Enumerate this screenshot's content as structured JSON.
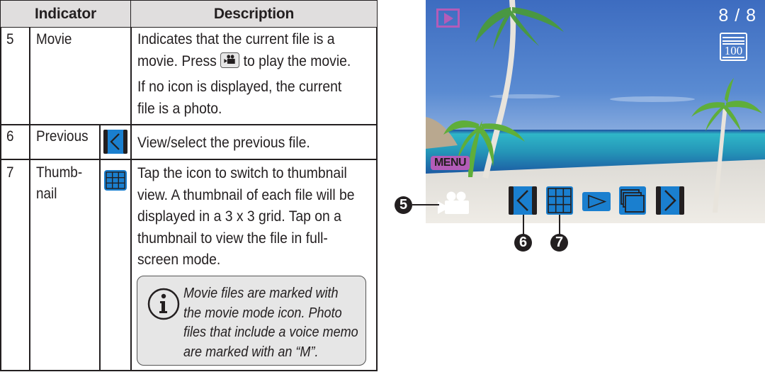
{
  "table": {
    "headers": {
      "indicator": "Indicator",
      "description": "Description"
    },
    "rows": [
      {
        "number": "5",
        "name": "Movie",
        "icon": "",
        "description_lines_1": [
          "Indicates that the current file is a"
        ],
        "description_line_2a": "movie. Press",
        "inline_icon": "movie-camera-button-icon",
        "description_line_2b": "to play the movie.",
        "description_para_2": [
          "If no icon is displayed, the current",
          "file is a photo."
        ]
      },
      {
        "number": "6",
        "name": "Previous",
        "icon": "previous-icon",
        "description": "View/select the previous file."
      },
      {
        "number": "7",
        "name_lines": [
          "Thumb-",
          "nail"
        ],
        "icon": "thumbnail-grid-icon",
        "description_lines": [
          "Tap the icon to switch to thumbnail",
          "view. A thumbnail of each file will be",
          "displayed in a 3 x 3 grid. Tap on a",
          "thumbnail to view the file in full-",
          "screen mode."
        ]
      }
    ],
    "note": {
      "icon": "info-icon",
      "lines": [
        "Movie files are marked with",
        "the movie mode icon. Photo",
        "files that include a voice memo",
        "are marked with an “M”."
      ]
    }
  },
  "screen": {
    "mode_icon": "playback-mode-icon",
    "counter": "8 / 8",
    "storage_icon": "internal-memory-icon",
    "storage_label": "100",
    "menu_label": "MENU",
    "file_type_icon": "movie-camera-icon",
    "controls": [
      {
        "name": "previous",
        "icon": "previous-icon"
      },
      {
        "name": "thumbnail",
        "icon": "thumbnail-grid-icon"
      },
      {
        "name": "play",
        "icon": "play-icon"
      },
      {
        "name": "slideshow",
        "icon": "slideshow-icon"
      },
      {
        "name": "next",
        "icon": "next-icon"
      }
    ],
    "callouts": [
      "5",
      "6",
      "7"
    ]
  },
  "colors": {
    "control_blue": "#1a7fcf",
    "menu_purple": "#b35cb8",
    "header_gray": "#e0dede",
    "note_gray": "#e6e6e6"
  }
}
